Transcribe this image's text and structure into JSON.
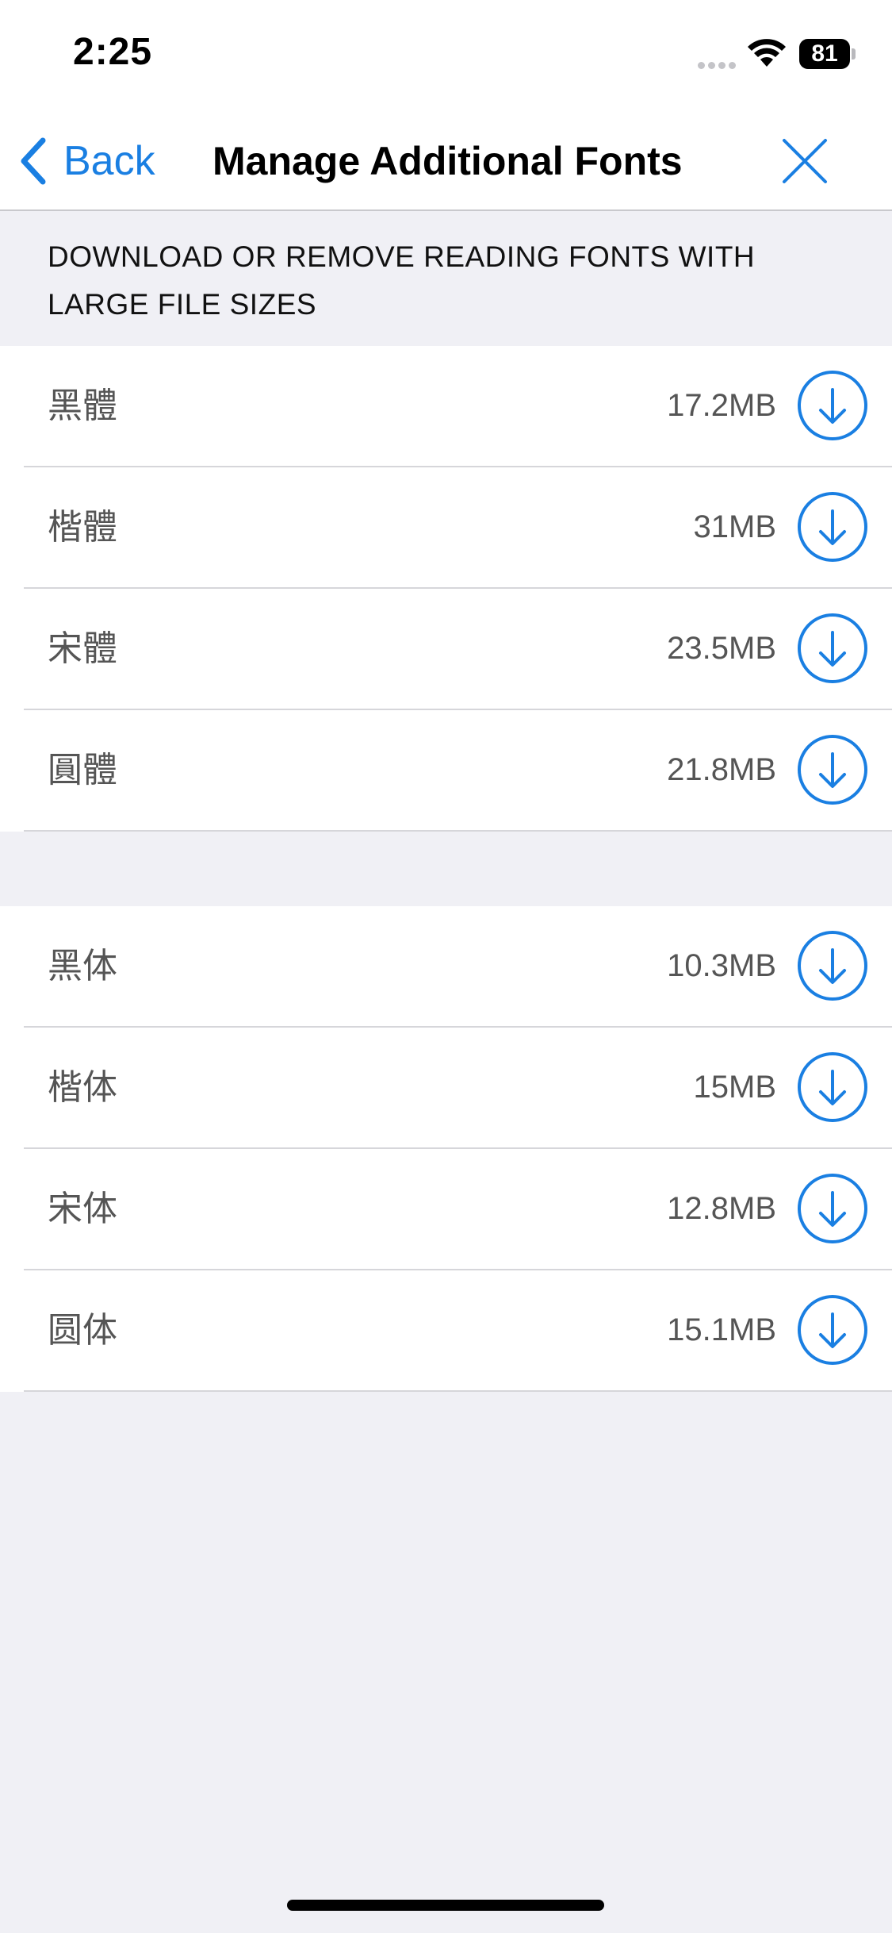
{
  "status_bar": {
    "time": "2:25",
    "battery": "81"
  },
  "nav": {
    "back_label": "Back",
    "title": "Manage Additional Fonts"
  },
  "section_header": "DOWNLOAD OR REMOVE READING FONTS WITH LARGE FILE SIZES",
  "traditional_fonts": [
    {
      "name": "黑體",
      "size": "17.2MB"
    },
    {
      "name": "楷體",
      "size": "31MB"
    },
    {
      "name": "宋體",
      "size": "23.5MB"
    },
    {
      "name": "圓體",
      "size": "21.8MB"
    }
  ],
  "simplified_fonts": [
    {
      "name": "黑体",
      "size": "10.3MB"
    },
    {
      "name": "楷体",
      "size": "15MB"
    },
    {
      "name": "宋体",
      "size": "12.8MB"
    },
    {
      "name": "圆体",
      "size": "15.1MB"
    }
  ],
  "colors": {
    "accent": "#1a7fe2",
    "background": "#f0f0f5"
  },
  "icons": {
    "back": "chevron-left-icon",
    "close": "close-icon",
    "download": "download-circle-icon"
  }
}
